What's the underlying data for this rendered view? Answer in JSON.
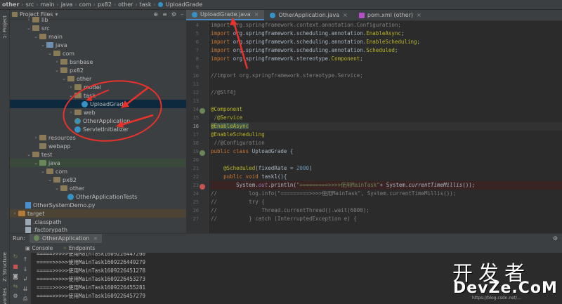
{
  "breadcrumb": [
    "other",
    "src",
    "main",
    "java",
    "com",
    "px82",
    "other",
    "task",
    "UploadGrade"
  ],
  "side_strip": {
    "project_label": "1: Project",
    "structure_label": "Z: Structure",
    "favorites_label": "Favorites"
  },
  "project_panel": {
    "title": "Project Files",
    "tree": [
      {
        "label": "lib",
        "icon": "folder"
      },
      {
        "label": "src",
        "icon": "folder"
      },
      {
        "label": "main",
        "icon": "folder"
      },
      {
        "label": "java",
        "icon": "folder-source"
      },
      {
        "label": "com",
        "icon": "folder"
      },
      {
        "label": "bsnbase",
        "icon": "folder"
      },
      {
        "label": "px82",
        "icon": "folder"
      },
      {
        "label": "other",
        "icon": "folder"
      },
      {
        "label": "model",
        "icon": "folder"
      },
      {
        "label": "task",
        "icon": "folder"
      },
      {
        "label": "UploadGrade",
        "icon": "class"
      },
      {
        "label": "web",
        "icon": "folder"
      },
      {
        "label": "OtherApplication",
        "icon": "spring-class"
      },
      {
        "label": "ServletInitializer",
        "icon": "class"
      },
      {
        "label": "resources",
        "icon": "folder"
      },
      {
        "label": "webapp",
        "icon": "folder"
      },
      {
        "label": "test",
        "icon": "folder"
      },
      {
        "label": "java",
        "icon": "folder-test"
      },
      {
        "label": "com",
        "icon": "folder"
      },
      {
        "label": "px82",
        "icon": "folder"
      },
      {
        "label": "other",
        "icon": "folder"
      },
      {
        "label": "OtherApplicationTests",
        "icon": "class"
      },
      {
        "label": "OtherSystemDemo.py",
        "icon": "python-file"
      },
      {
        "label": "target",
        "icon": "folder-excluded"
      },
      {
        "label": ".classpath",
        "icon": "file"
      },
      {
        "label": ".factorypath",
        "icon": "file"
      }
    ]
  },
  "editor_tabs": [
    {
      "label": "UploadGrade.java",
      "icon": "class"
    },
    {
      "label": "OtherApplication.java",
      "icon": "class"
    },
    {
      "label": "pom.xml (other)",
      "icon": "maven"
    }
  ],
  "line_numbers": [
    "4",
    "5",
    "6",
    "7",
    "8",
    "9",
    "10",
    "11",
    "12",
    "13",
    "14",
    "15",
    "16",
    "17",
    "18",
    "19",
    "20",
    "21",
    "22",
    "23",
    "24",
    "25",
    "26",
    "27"
  ],
  "code_lines": [
    [
      [
        "cm",
        "import org.springframework.context.annotation.Configuration;"
      ]
    ],
    [
      [
        "kw",
        "import "
      ],
      [
        "",
        "org.springframework.scheduling.annotation."
      ],
      [
        "an",
        "EnableAsync"
      ],
      [
        "",
        ";"
      ]
    ],
    [
      [
        "kw",
        "import "
      ],
      [
        "",
        "org.springframework.scheduling.annotation."
      ],
      [
        "an",
        "EnableScheduling"
      ],
      [
        "",
        ";"
      ]
    ],
    [
      [
        "kw",
        "import "
      ],
      [
        "",
        "org.springframework.scheduling.annotation."
      ],
      [
        "an",
        "Scheduled"
      ],
      [
        "",
        ";"
      ]
    ],
    [
      [
        "kw",
        "import "
      ],
      [
        "",
        "org.springframework.stereotype."
      ],
      [
        "an",
        "Component"
      ],
      [
        "",
        ";"
      ]
    ],
    [],
    [
      [
        "cm",
        "//import org.springframework.stereotype.Service;"
      ]
    ],
    [],
    [
      [
        "cm",
        "//@Slf4j"
      ]
    ],
    [],
    [
      [
        "an",
        "@Component"
      ]
    ],
    [
      [
        "cm",
        " /"
      ],
      [
        "an",
        "@Service"
      ]
    ],
    [
      [
        "an hl",
        "@EnableAsync"
      ]
    ],
    [
      [
        "an",
        "@EnableScheduling"
      ]
    ],
    [
      [
        "cm",
        " //@Configuration"
      ]
    ],
    [
      [
        "kw",
        "public class "
      ],
      [
        "",
        "UploadGrade {"
      ]
    ],
    [],
    [
      [
        "",
        "    "
      ],
      [
        "an",
        "@Scheduled"
      ],
      [
        "",
        "(fixedRate = "
      ],
      [
        "num",
        "2000"
      ],
      [
        "",
        ")"
      ]
    ],
    [
      [
        "",
        "    "
      ],
      [
        "kw",
        "public void "
      ],
      [
        "",
        "task1(){"
      ]
    ],
    [
      [
        "",
        "        System."
      ],
      [
        "fld it",
        "out"
      ],
      [
        "",
        ".println("
      ],
      [
        "str",
        "\"=========>>>>使用MainTask\""
      ],
      [
        "",
        "+ System."
      ],
      [
        "it",
        "currentTimeMillis"
      ],
      [
        "",
        "());"
      ]
    ],
    [
      [
        "cm",
        "//          log.info(\"=========>>>>使用MainTask\", System.currentTimeMillis());"
      ]
    ],
    [
      [
        "cm",
        "//          try {"
      ]
    ],
    [
      [
        "cm",
        "//              Thread.currentThread().wait(6000);"
      ]
    ],
    [
      [
        "cm",
        "//          } catch (InterruptedException e) {"
      ]
    ]
  ],
  "run_panel": {
    "run_label": "Run:",
    "config_name": "OtherApplication",
    "tabs": [
      "Console",
      "Endpoints"
    ],
    "output": [
      "=====>>>>>使用MainTask1609226447200",
      "=====>>>>>使用MainTask1609226449279",
      "=====>>>>>使用MainTask1609226451278",
      "=====>>>>>使用MainTask1609226453273",
      "=====>>>>>使用MainTask1609226455281",
      "=====>>>>>使用MainTask1609226457279"
    ]
  },
  "watermark": {
    "line1": "开发者",
    "line2": "DevZe.CoM",
    "line3": "https://blog.csdn.net/..."
  },
  "colors": {
    "annotation_circle": "#e8322b",
    "selection": "#0d293e",
    "accent": "#4a88c7"
  }
}
